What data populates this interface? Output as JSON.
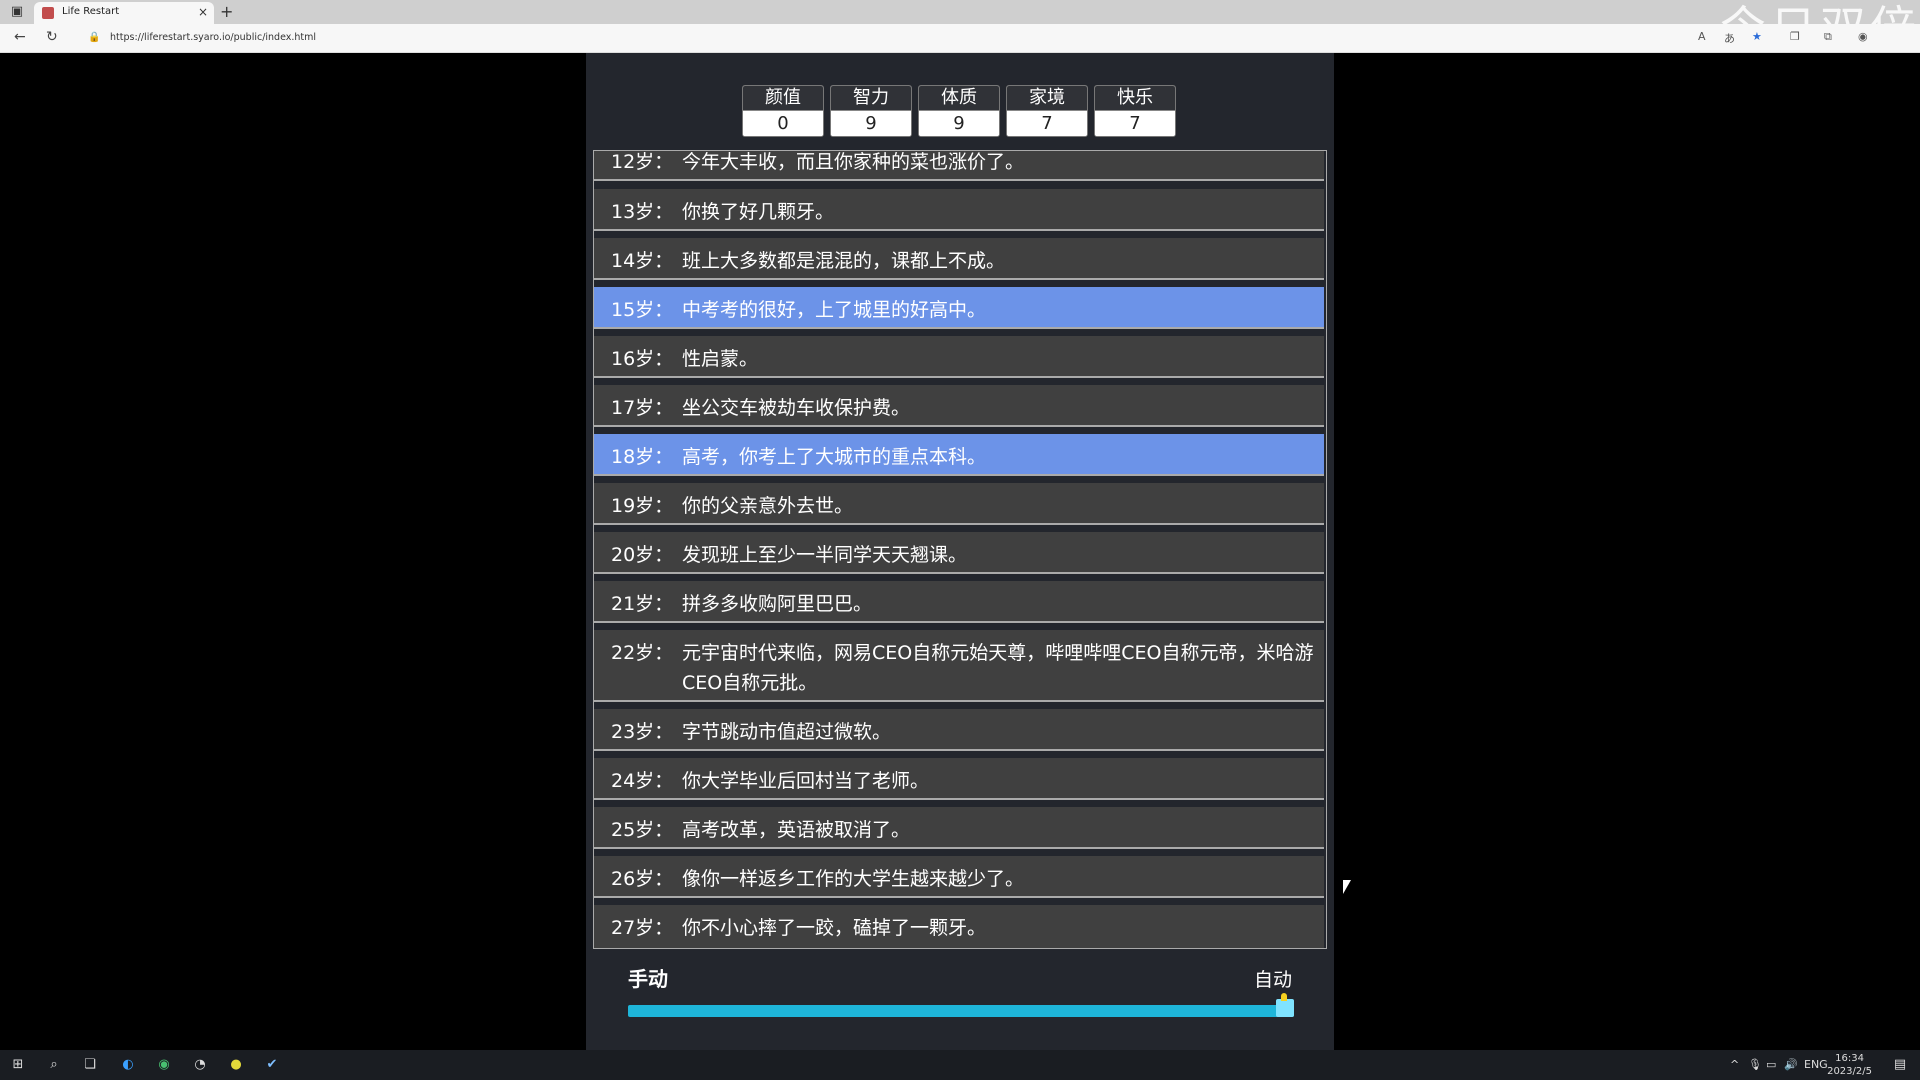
{
  "browser": {
    "tab_title": "Life Restart",
    "new_tab": "+",
    "close": "×",
    "url": "https://liferestart.syaro.io/public/index.html",
    "back": "←",
    "reload": "↻",
    "watermark": "今日双倍"
  },
  "properties": [
    {
      "label": "颜值",
      "value": "0"
    },
    {
      "label": "智力",
      "value": "9"
    },
    {
      "label": "体质",
      "value": "9"
    },
    {
      "label": "家境",
      "value": "7"
    },
    {
      "label": "快乐",
      "value": "7"
    }
  ],
  "events": [
    {
      "age": "12岁：",
      "text": "今年大丰收，而且你家种的菜也涨价了。",
      "highlight": false
    },
    {
      "age": "13岁：",
      "text": "你换了好几颗牙。",
      "highlight": false
    },
    {
      "age": "14岁：",
      "text": "班上大多数都是混混的，课都上不成。",
      "highlight": false
    },
    {
      "age": "15岁：",
      "text": "中考考的很好，上了城里的好高中。",
      "highlight": true
    },
    {
      "age": "16岁：",
      "text": "性启蒙。",
      "highlight": false
    },
    {
      "age": "17岁：",
      "text": "坐公交车被劫车收保护费。",
      "highlight": false
    },
    {
      "age": "18岁：",
      "text": "高考，你考上了大城市的重点本科。",
      "highlight": true
    },
    {
      "age": "19岁：",
      "text": "你的父亲意外去世。",
      "highlight": false
    },
    {
      "age": "20岁：",
      "text": "发现班上至少一半同学天天翘课。",
      "highlight": false
    },
    {
      "age": "21岁：",
      "text": "拼多多收购阿里巴巴。",
      "highlight": false
    },
    {
      "age": "22岁：",
      "text": "元宇宙时代来临，网易CEO自称元始天尊，哔哩哔哩CEO自称元帝，米哈游CEO自称元批。",
      "highlight": false
    },
    {
      "age": "23岁：",
      "text": "字节跳动市值超过微软。",
      "highlight": false
    },
    {
      "age": "24岁：",
      "text": "你大学毕业后回村当了老师。",
      "highlight": false
    },
    {
      "age": "25岁：",
      "text": "高考改革，英语被取消了。",
      "highlight": false
    },
    {
      "age": "26岁：",
      "text": "像你一样返乡工作的大学生越来越少了。",
      "highlight": false
    },
    {
      "age": "27岁：",
      "text": "你不小心摔了一跤，磕掉了一颗牙。",
      "highlight": false
    }
  ],
  "mode": {
    "manual": "手动",
    "auto": "自动",
    "slider_fraction": 1.0
  },
  "taskbar": {
    "lang": "ENG",
    "time": "16:34",
    "date": "2023/2/5"
  },
  "colors": {
    "highlight": "#6c93e8",
    "item_bg": "#404040",
    "slider": "#1eb5d9"
  }
}
